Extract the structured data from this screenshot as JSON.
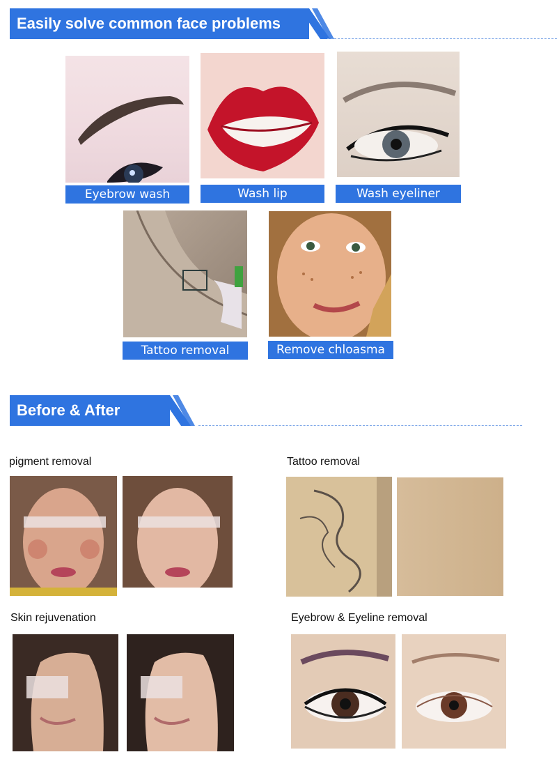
{
  "section1": {
    "title": "Easily solve common face problems",
    "items": [
      {
        "label": "Eyebrow wash",
        "image": "eyebrow-photo"
      },
      {
        "label": "Wash lip",
        "image": "lips-photo"
      },
      {
        "label": "Wash  eyeliner",
        "image": "eyeliner-photo"
      },
      {
        "label": "Tattoo removal",
        "image": "tattoo-photo"
      },
      {
        "label": "Remove chloasma",
        "image": "freckles-face-photo"
      }
    ]
  },
  "section2": {
    "title": "Before & After",
    "groups": [
      {
        "caption": "pigment removal"
      },
      {
        "caption": "Tattoo removal"
      },
      {
        "caption": "Skin rejuvenation"
      },
      {
        "caption": "Eyebrow & Eyeline removal"
      }
    ]
  },
  "colors": {
    "accent": "#2f74e0",
    "dash": "#7fa8e8"
  }
}
